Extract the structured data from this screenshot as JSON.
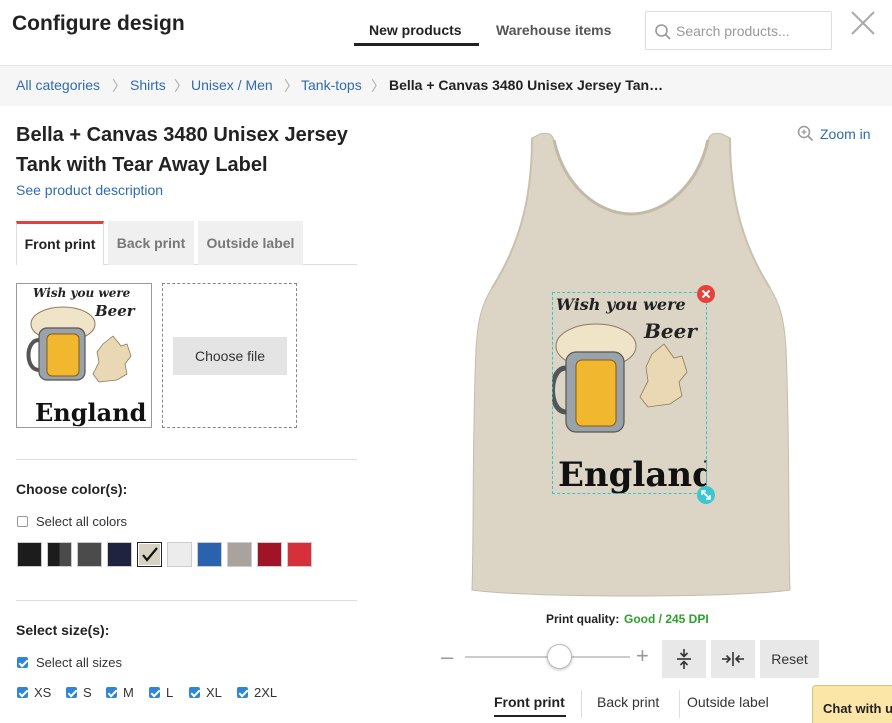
{
  "header": {
    "title": "Configure design",
    "tabs": [
      {
        "label": "New products",
        "active": true
      },
      {
        "label": "Warehouse items",
        "active": false
      }
    ],
    "search_placeholder": "Search products..."
  },
  "breadcrumb": [
    {
      "label": "All categories"
    },
    {
      "label": "Shirts"
    },
    {
      "label": "Unisex / Men"
    },
    {
      "label": "Tank-tops"
    },
    {
      "label": "Bella + Canvas 3480 Unisex Jersey Tan…"
    }
  ],
  "breadcrumb_separator": "〉",
  "product": {
    "title": "Bella + Canvas 3480 Unisex Jersey Tank with Tear Away Label",
    "description_link": "See product description"
  },
  "print_tabs": [
    {
      "label": "Front print",
      "active": true
    },
    {
      "label": "Back print",
      "active": false
    },
    {
      "label": "Outside label",
      "active": false
    }
  ],
  "upload": {
    "choose_file_label": "Choose file"
  },
  "design": {
    "line1": "Wish you were",
    "line2": "Beer",
    "line3": "England"
  },
  "colors": {
    "heading": "Choose color(s):",
    "select_all_label": "Select all colors",
    "select_all_checked": false,
    "swatches": [
      {
        "name": "black",
        "color": "#1c1c1c",
        "selected": false
      },
      {
        "name": "black-heather",
        "color": "#3a3a3a",
        "selected": false
      },
      {
        "name": "dark-grey",
        "color": "#4b4b4b",
        "selected": false
      },
      {
        "name": "navy",
        "color": "#1f2340",
        "selected": false
      },
      {
        "name": "oatmeal",
        "color": "#d8d2c4",
        "selected": true
      },
      {
        "name": "white",
        "color": "#ececec",
        "selected": false
      },
      {
        "name": "true-royal",
        "color": "#2a62ad",
        "selected": false
      },
      {
        "name": "athletic-heather",
        "color": "#a8a39d",
        "selected": false
      },
      {
        "name": "cardinal",
        "color": "#a11427",
        "selected": false
      },
      {
        "name": "red",
        "color": "#d6303a",
        "selected": false
      }
    ]
  },
  "sizes": {
    "heading": "Select size(s):",
    "select_all_label": "Select all sizes",
    "select_all_checked": true,
    "items": [
      {
        "label": "XS",
        "checked": true
      },
      {
        "label": "S",
        "checked": true
      },
      {
        "label": "M",
        "checked": true
      },
      {
        "label": "L",
        "checked": true
      },
      {
        "label": "XL",
        "checked": true
      },
      {
        "label": "2XL",
        "checked": true
      }
    ]
  },
  "preview": {
    "zoom_label": "Zoom in",
    "print_quality_label": "Print quality:",
    "print_quality_value": "Good / 245 DPI",
    "scale_fraction": 0.57,
    "reset_label": "Reset",
    "garment_color": "#dcd5c6"
  },
  "bottom_tabs": [
    {
      "label": "Front print",
      "active": true
    },
    {
      "label": "Back print",
      "active": false
    },
    {
      "label": "Outside label",
      "active": false
    }
  ],
  "chat_label": "Chat with us"
}
